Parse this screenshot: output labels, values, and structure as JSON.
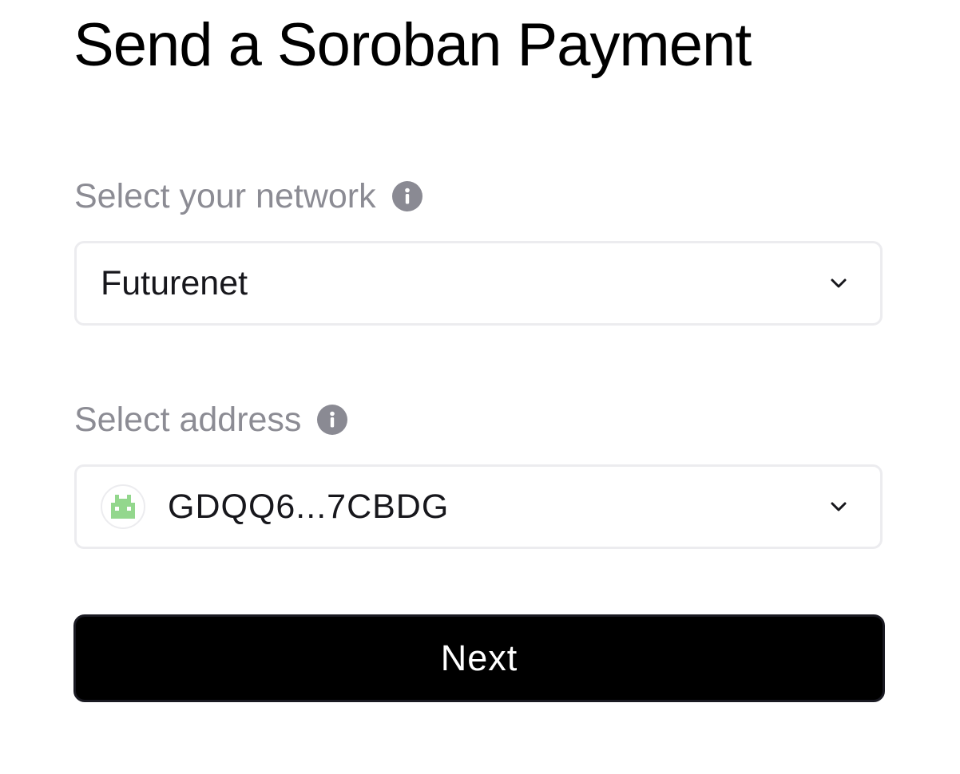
{
  "header": {
    "title": "Send a Soroban Payment"
  },
  "network": {
    "label": "Select your network",
    "info_icon": "info-icon",
    "selected_value": "Futurenet",
    "chevron_icon": "chevron-down-icon"
  },
  "address": {
    "label": "Select address",
    "info_icon": "info-icon",
    "avatar_icon": "identicon-avatar",
    "avatar_color": "#93d78d",
    "selected_value": "GDQQ6...7CBDG",
    "chevron_icon": "chevron-down-icon"
  },
  "actions": {
    "next_label": "Next"
  },
  "colors": {
    "title": "#000000",
    "label": "#8c8c94",
    "info_icon": "#8a8a93",
    "field_border": "#ececef",
    "button_background": "#000000",
    "button_text": "#ffffff"
  }
}
